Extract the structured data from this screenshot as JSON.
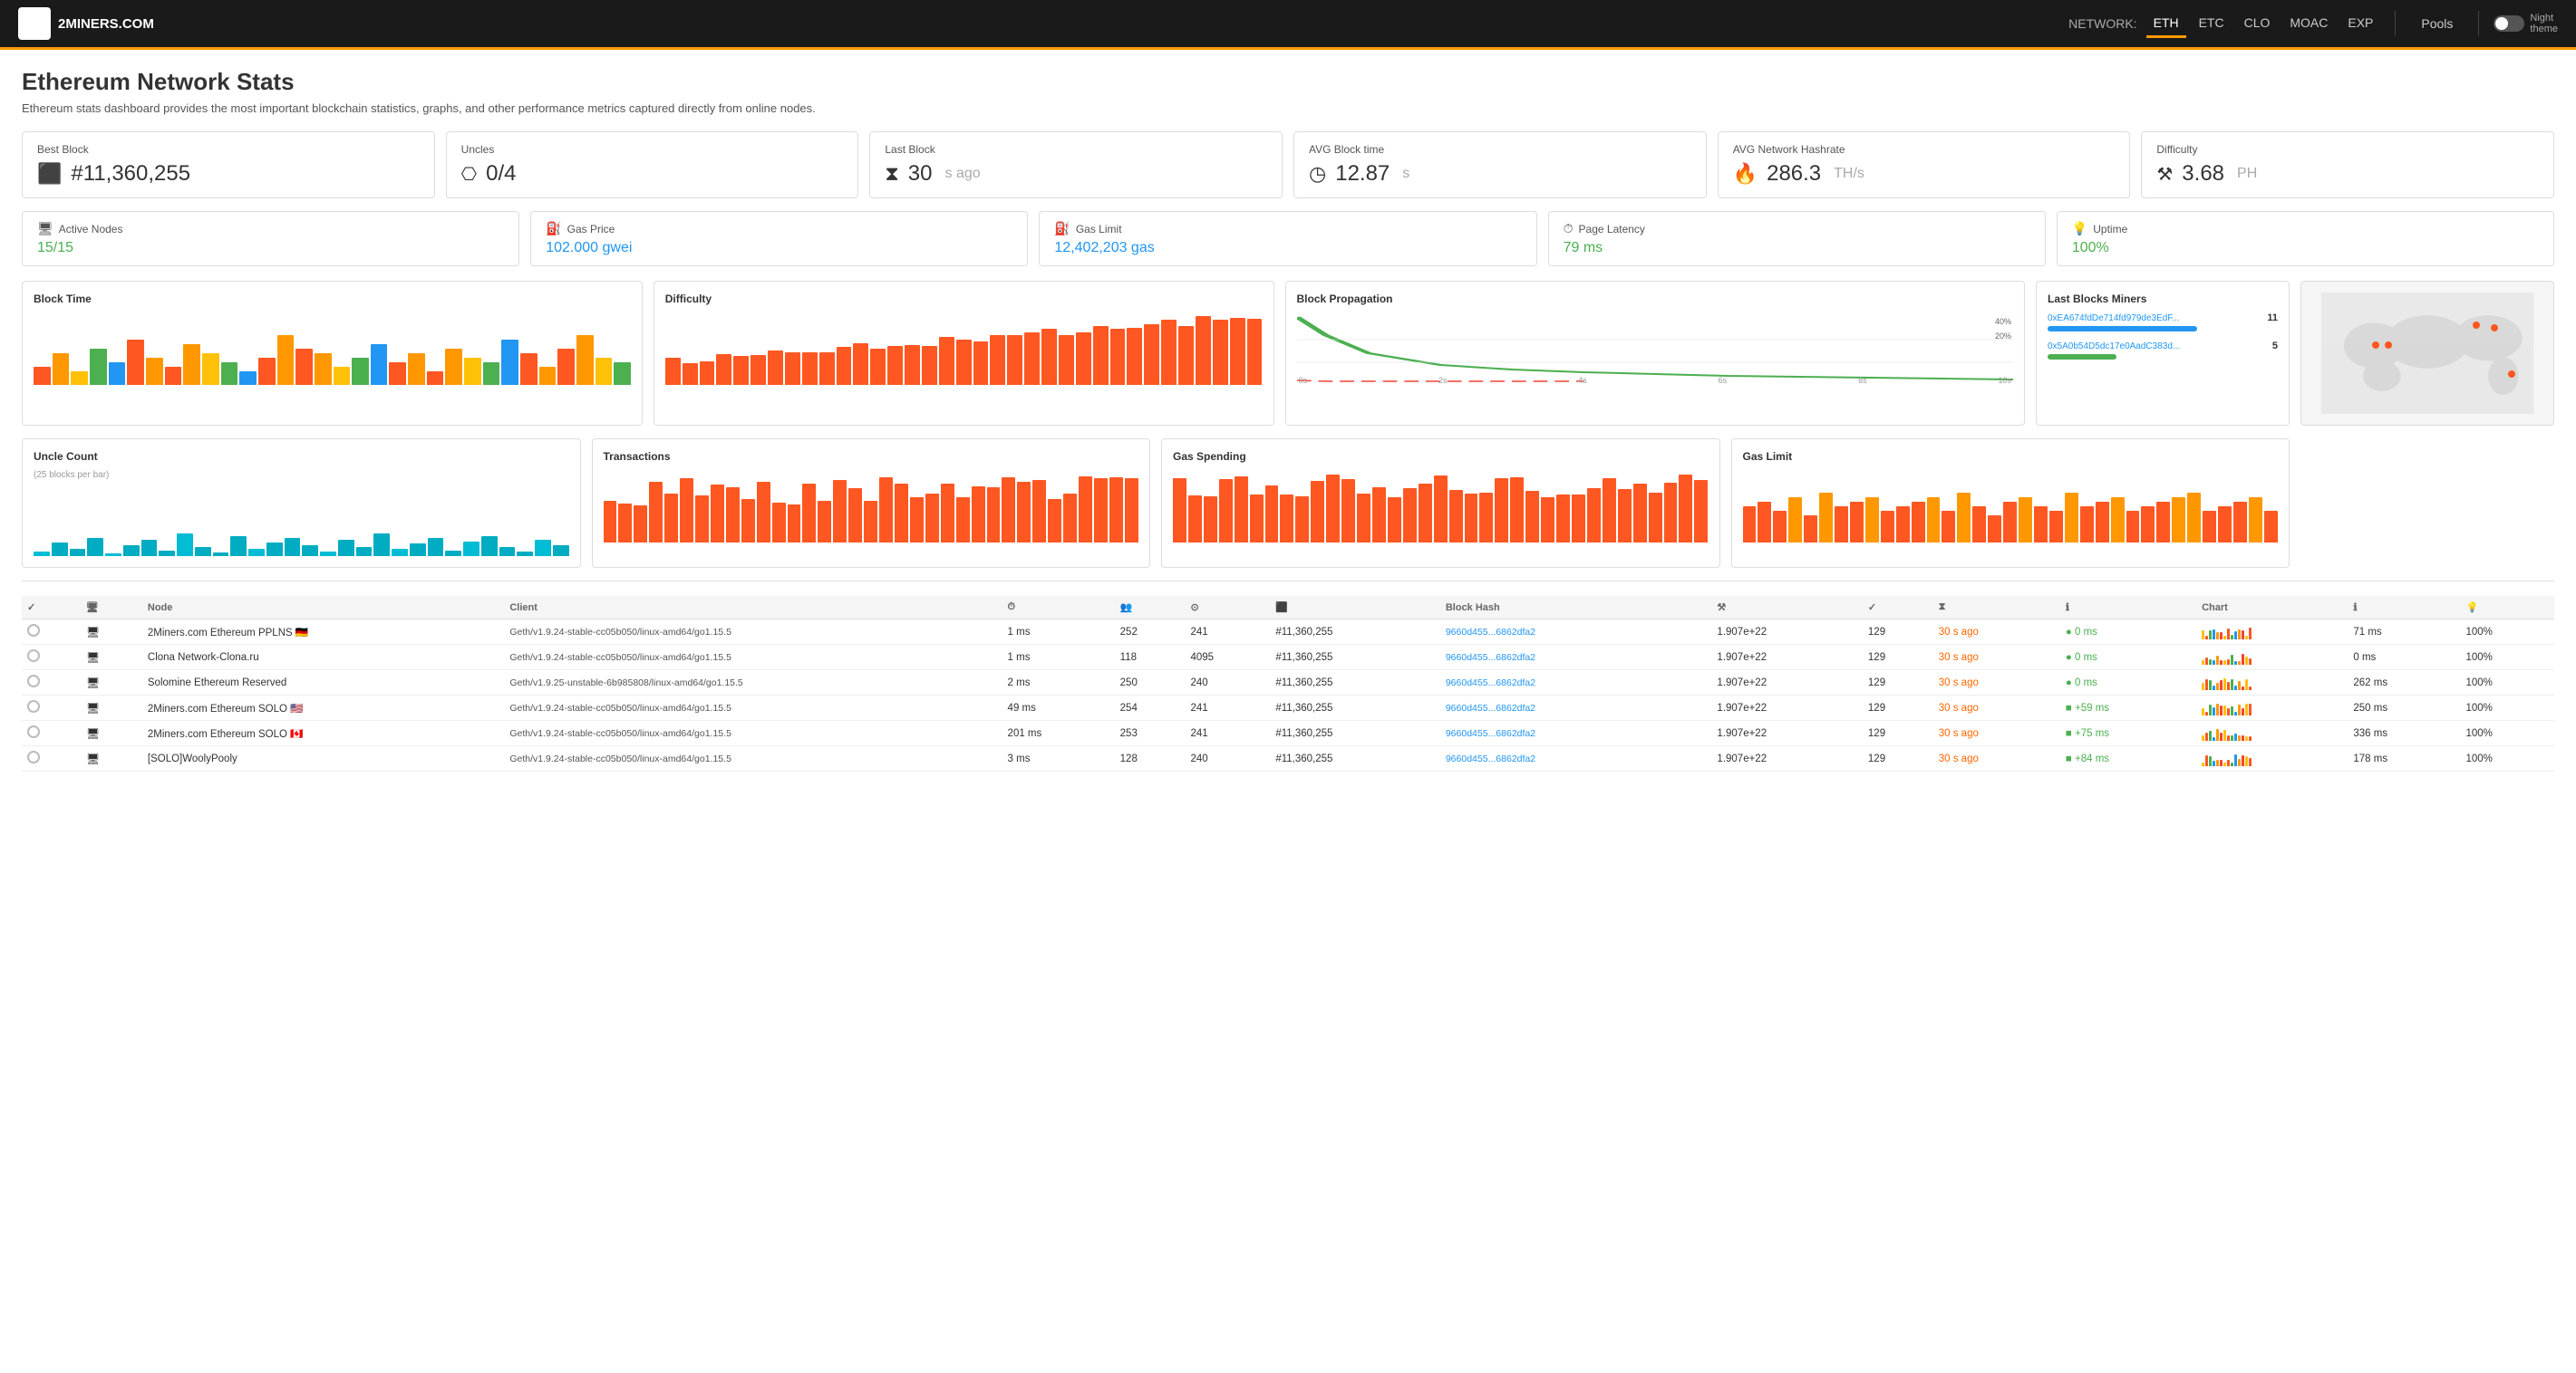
{
  "nav": {
    "brand": "2MINERS.COM",
    "network_label": "NETWORK:",
    "links": [
      "ETH",
      "ETC",
      "CLO",
      "MOAC",
      "EXP"
    ],
    "active_link": "ETH",
    "pools_label": "Pools",
    "night_label": "Night\ntheme"
  },
  "page": {
    "title": "Ethereum Network Stats",
    "desc": "Ethereum stats dashboard provides the most important blockchain statistics, graphs, and other performance metrics captured directly from online nodes."
  },
  "stats_row1": [
    {
      "id": "best-block",
      "label": "Best Block",
      "icon": "⬜",
      "value": "#11,360,255",
      "unit": ""
    },
    {
      "id": "uncles",
      "label": "Uncles",
      "icon": "⚙",
      "value": "0/4",
      "unit": ""
    },
    {
      "id": "last-block",
      "label": "Last Block",
      "icon": "⧖",
      "value": "30",
      "unit": "s ago"
    },
    {
      "id": "avg-block-time",
      "label": "AVG Block time",
      "icon": "◷",
      "value": "12.87",
      "unit": "s"
    },
    {
      "id": "avg-hashrate",
      "label": "AVG Network Hashrate",
      "icon": "🔥",
      "value": "286.3",
      "unit": "TH/s"
    },
    {
      "id": "difficulty",
      "label": "Difficulty",
      "icon": "🐾",
      "value": "3.68",
      "unit": "PH"
    }
  ],
  "stats_row2": [
    {
      "id": "active-nodes",
      "label": "Active Nodes",
      "icon": "💻",
      "value": "15/15",
      "color": "green"
    },
    {
      "id": "gas-price",
      "label": "Gas Price",
      "icon": "⛽",
      "value": "102.000 gwei",
      "color": "blue"
    },
    {
      "id": "gas-limit",
      "label": "Gas Limit",
      "icon": "⛽",
      "value": "12,402,203 gas",
      "color": "blue"
    },
    {
      "id": "page-latency",
      "label": "Page Latency",
      "icon": "⏱",
      "value": "79 ms",
      "color": "green"
    },
    {
      "id": "uptime",
      "label": "Uptime",
      "icon": "💡",
      "value": "100%",
      "color": "green"
    }
  ],
  "charts_row1": [
    {
      "id": "block-time",
      "title": "Block Time",
      "type": "bar",
      "color": "mixed"
    },
    {
      "id": "difficulty-chart",
      "title": "Difficulty",
      "type": "bar",
      "color": "orange"
    },
    {
      "id": "block-propagation",
      "title": "Block Propagation",
      "type": "line"
    }
  ],
  "charts_row2": [
    {
      "id": "uncle-count",
      "title": "Uncle Count",
      "subtitle": "(25 blocks per bar)",
      "type": "bar",
      "color": "cyan"
    },
    {
      "id": "transactions",
      "title": "Transactions",
      "type": "bar",
      "color": "orange"
    },
    {
      "id": "gas-spending",
      "title": "Gas Spending",
      "type": "bar",
      "color": "orange"
    },
    {
      "id": "gas-limit-chart",
      "title": "Gas Limit",
      "type": "bar",
      "color": "orange"
    }
  ],
  "last_blocks_miners": {
    "title": "Last Blocks Miners",
    "miners": [
      {
        "addr": "0xEA674fdDe714fd979de3EdF...",
        "count": 11,
        "color": "#2196f3",
        "pct": 65
      },
      {
        "addr": "0x5A0b54D5dc17e0AadC383d...",
        "count": 5,
        "color": "#4caf50",
        "pct": 30
      }
    ]
  },
  "table": {
    "headers": [
      "",
      "",
      "Node",
      "Client",
      "Latency",
      "Peers",
      "Pending",
      "Last Block",
      "Block Hash",
      "Difficulty",
      "TXs",
      "Last Update",
      "Propagation",
      "Chart",
      "Latency",
      "Uptime"
    ],
    "rows": [
      {
        "name": "2Miners.com Ethereum PPLNS 🇩🇪",
        "client": "Geth/v1.9.24-stable-cc05b050/linux-amd64/go1.15.5",
        "latency": "1 ms",
        "peers": "252",
        "pending": "241",
        "block": "#11,360,255",
        "hash": "9660d455...6862dfa2",
        "diff": "1.907e+22",
        "txs": "129",
        "last_update": "30 s ago",
        "last_update_color": "orange",
        "propagation": "● 0 ms",
        "prop_color": "green",
        "latency2": "71 ms",
        "uptime": "100%"
      },
      {
        "name": "Clona Network-Clona.ru",
        "client": "Geth/v1.9.24-stable-cc05b050/linux-amd64/go1.15.5",
        "latency": "1 ms",
        "peers": "118",
        "pending": "4095",
        "block": "#11,360,255",
        "hash": "9660d455...6862dfa2",
        "diff": "1.907e+22",
        "txs": "129",
        "last_update": "30 s ago",
        "last_update_color": "orange",
        "propagation": "● 0 ms",
        "prop_color": "green",
        "latency2": "0 ms",
        "uptime": "100%"
      },
      {
        "name": "Solomine Ethereum Reserved",
        "client": "Geth/v1.9.25-unstable-6b985808/linux-amd64/go1.15.5",
        "latency": "2 ms",
        "peers": "250",
        "pending": "240",
        "block": "#11,360,255",
        "hash": "9660d455...6862dfa2",
        "diff": "1.907e+22",
        "txs": "129",
        "last_update": "30 s ago",
        "last_update_color": "orange",
        "propagation": "● 0 ms",
        "prop_color": "green",
        "latency2": "262 ms",
        "uptime": "100%"
      },
      {
        "name": "2Miners.com Ethereum SOLO 🇺🇸",
        "client": "Geth/v1.9.24-stable-cc05b050/linux-amd64/go1.15.5",
        "latency": "49 ms",
        "peers": "254",
        "pending": "241",
        "block": "#11,360,255",
        "hash": "9660d455...6862dfa2",
        "diff": "1.907e+22",
        "txs": "129",
        "last_update": "30 s ago",
        "last_update_color": "orange",
        "propagation": "■ +59 ms",
        "prop_color": "green",
        "latency2": "250 ms",
        "uptime": "100%"
      },
      {
        "name": "2Miners.com Ethereum SOLO 🇨🇦",
        "client": "Geth/v1.9.24-stable-cc05b050/linux-amd64/go1.15.5",
        "latency": "201 ms",
        "peers": "253",
        "pending": "241",
        "block": "#11,360,255",
        "hash": "9660d455...6862dfa2",
        "diff": "1.907e+22",
        "txs": "129",
        "last_update": "30 s ago",
        "last_update_color": "orange",
        "propagation": "■ +75 ms",
        "prop_color": "green",
        "latency2": "336 ms",
        "uptime": "100%"
      },
      {
        "name": "[SOLO]WoolyPooly",
        "client": "Geth/v1.9.24-stable-cc05b050/linux-amd64/go1.15.5",
        "latency": "3 ms",
        "peers": "128",
        "pending": "240",
        "block": "#11,360,255",
        "hash": "9660d455...6862dfa2",
        "diff": "1.907e+22",
        "txs": "129",
        "last_update": "30 s ago",
        "last_update_color": "orange",
        "propagation": "■ +84 ms",
        "prop_color": "green",
        "latency2": "178 ms",
        "uptime": "100%"
      }
    ]
  },
  "colors": {
    "orange": "#ff6600",
    "orange_bar": "#ff5722",
    "cyan": "#00bcd4",
    "green": "#4caf50",
    "blue": "#2196f3",
    "mixed_bar": [
      "#ff5722",
      "#ffc107",
      "#4caf50",
      "#2196f3"
    ]
  }
}
